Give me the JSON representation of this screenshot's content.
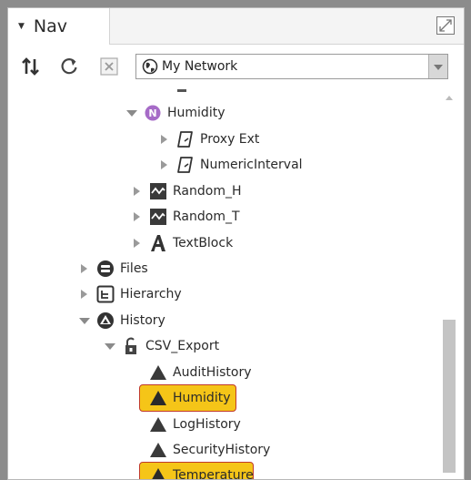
{
  "panel": {
    "title": "Nav"
  },
  "toolbar": {
    "network_select": "My Network",
    "buttons": [
      "sort-icon",
      "refresh-icon",
      "close-icon"
    ]
  },
  "tree": {
    "humidity_folder": "Humidity",
    "proxy_ext": "Proxy Ext",
    "numeric_interval": "NumericInterval",
    "random_h": "Random_H",
    "random_t": "Random_T",
    "text_block": "TextBlock",
    "files": "Files",
    "hierarchy": "Hierarchy",
    "history": "History",
    "csv_export": "CSV_Export",
    "audit_history": "AuditHistory",
    "humidity_history": "Humidity",
    "log_history": "LogHistory",
    "security_history": "SecurityHistory",
    "temperature_history": "Temperature"
  },
  "colors": {
    "highlight": "#f5c518",
    "highlight_border": "#c0392b",
    "humidity_badge": "#a66bc7"
  }
}
